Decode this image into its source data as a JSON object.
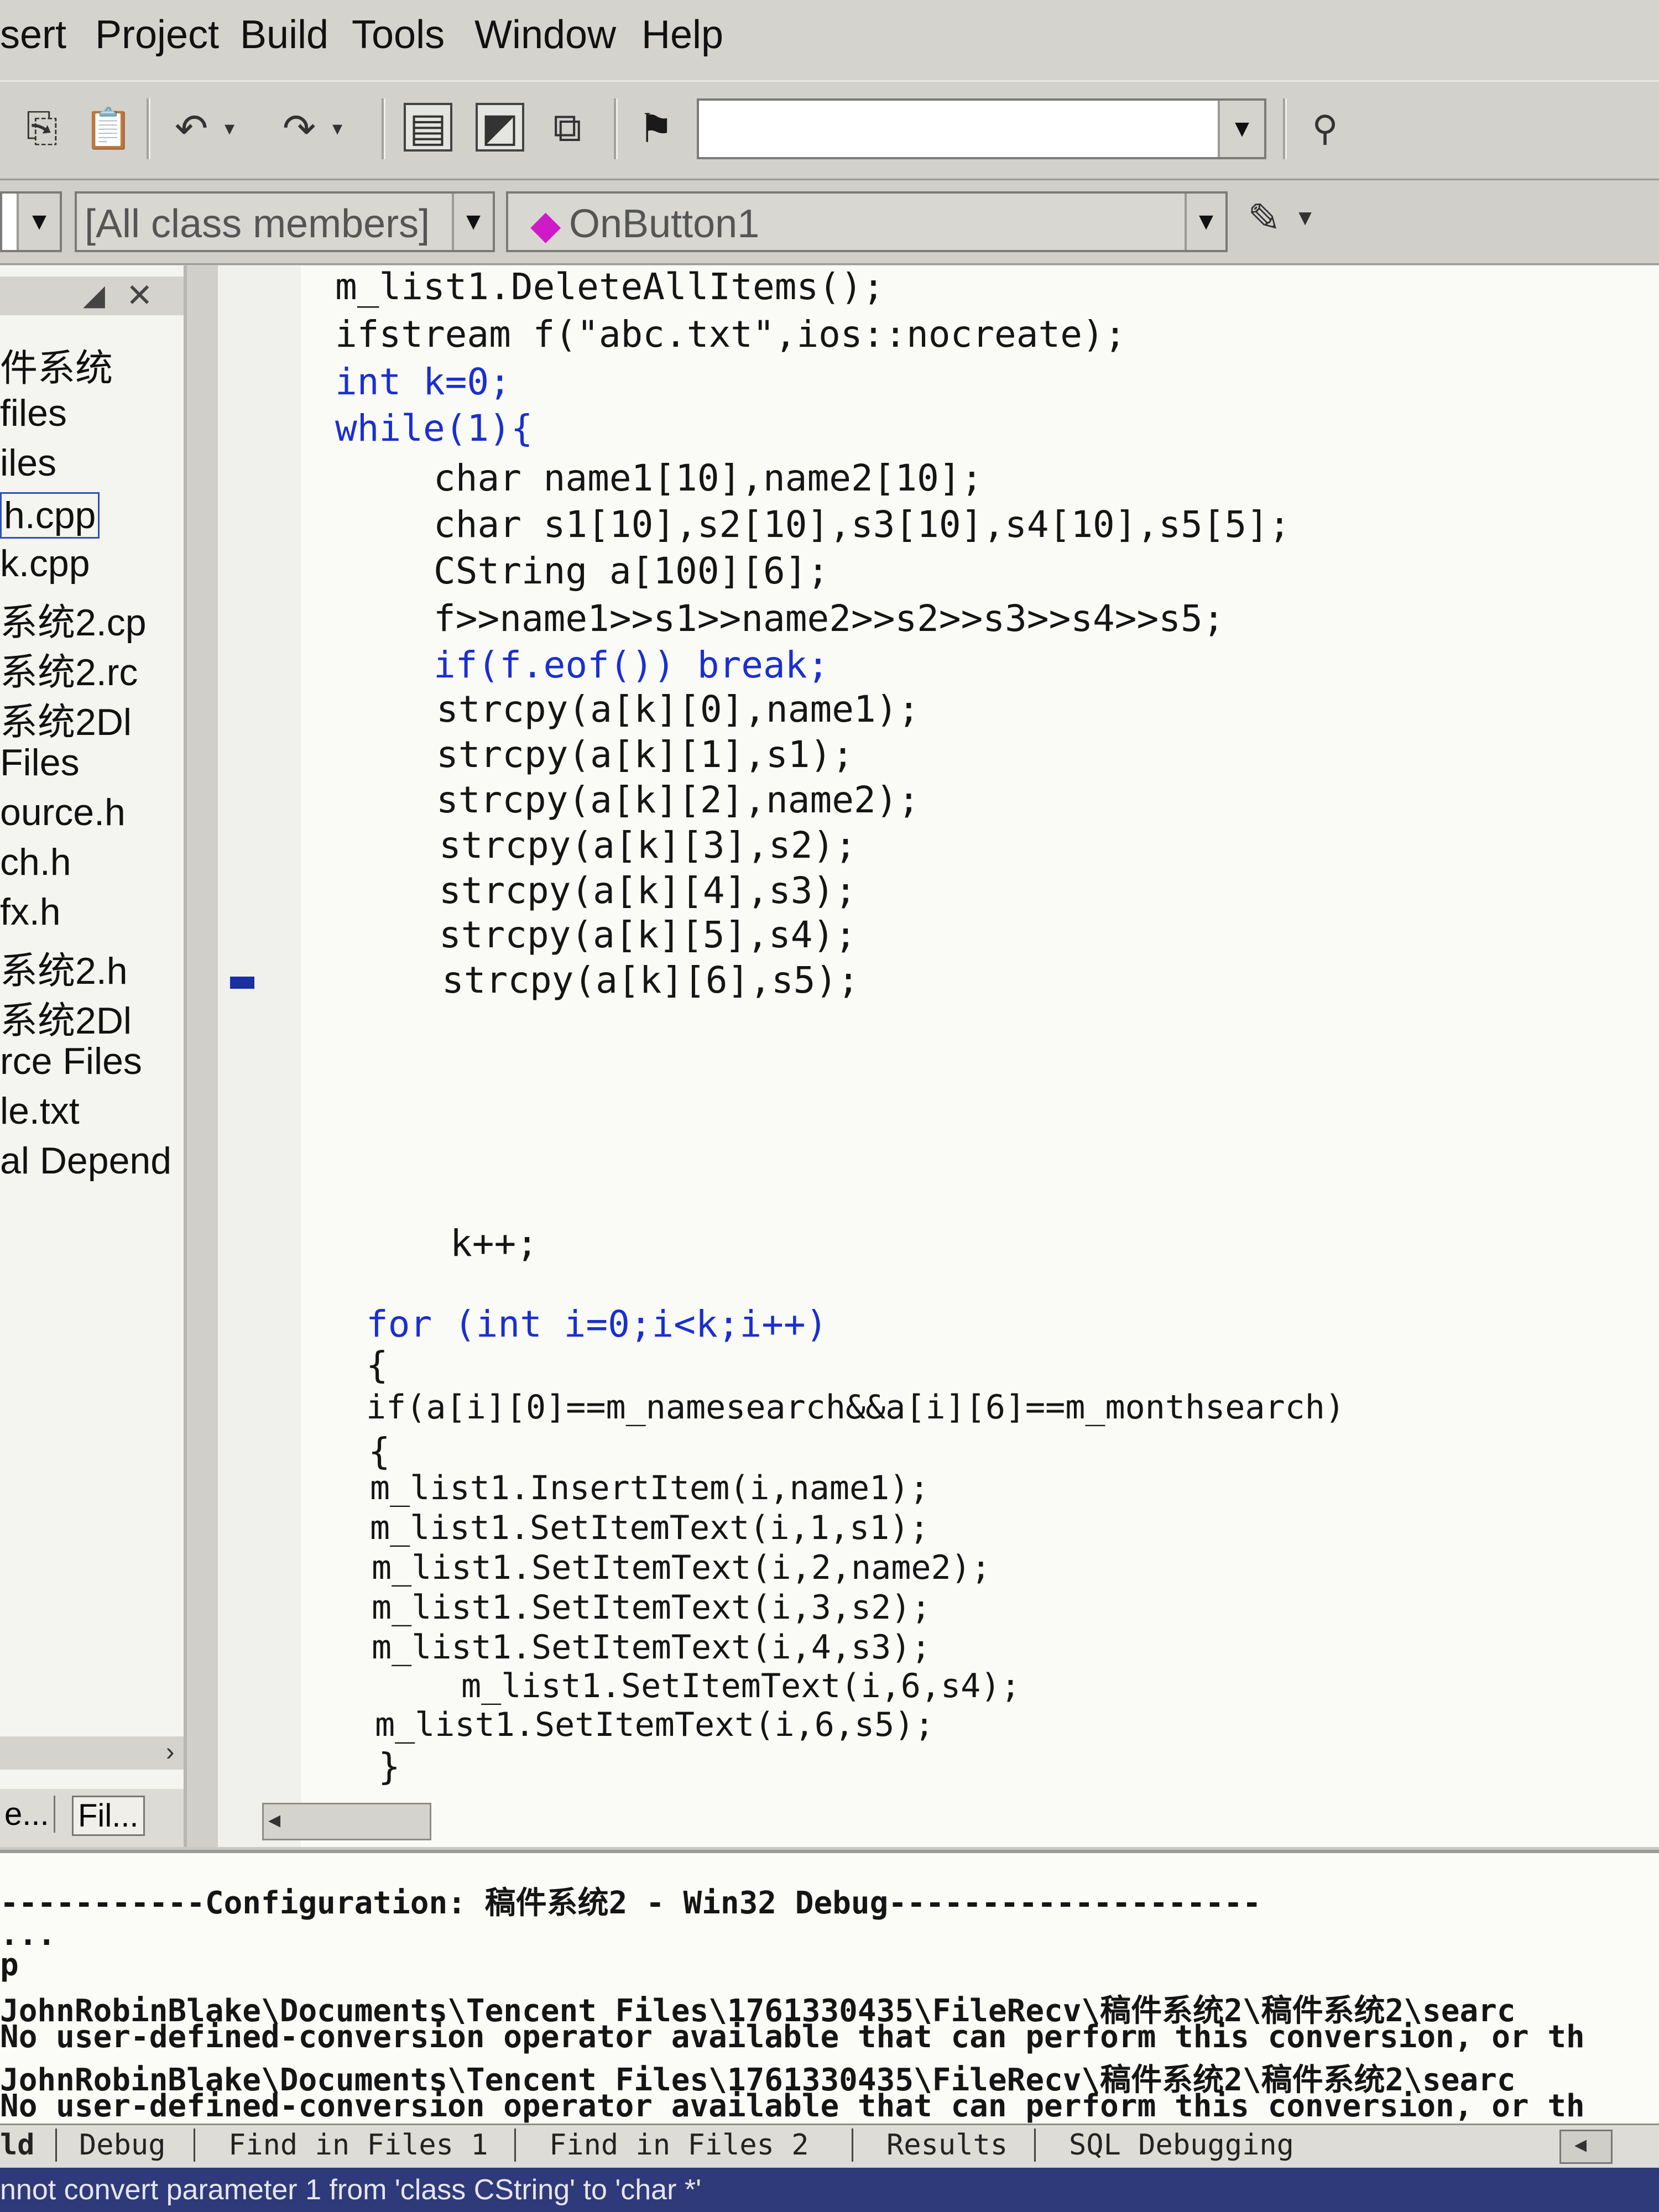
{
  "menu": [
    "sert",
    "Project",
    "Build",
    "Tools",
    "Window",
    "Help"
  ],
  "wizard": {
    "class_members": "[All class members]",
    "function": "OnButton1"
  },
  "workspace": {
    "items": [
      "件系统",
      "files",
      "iles",
      "h.cpp",
      "k.cpp",
      "系统2.cp",
      "系统2.rc",
      "系统2Dl",
      "Files",
      "ource.h",
      "ch.h",
      "fx.h",
      "系统2.h",
      "系统2Dl",
      "rce Files",
      "le.txt",
      "al Depend"
    ],
    "tabs": [
      "e...",
      "Fil..."
    ]
  },
  "code": [
    "m_list1.DeleteAllItems();",
    "ifstream f(\"abc.txt\",ios::nocreate);",
    "int k=0;",
    "while(1){",
    "char name1[10],name2[10];",
    "char s1[10],s2[10],s3[10],s4[10],s5[5];",
    "CString a[100][6];",
    "f>>name1>>s1>>name2>>s2>>s3>>s4>>s5;",
    "if(f.eof()) break;",
    "strcpy(a[k][0],name1);",
    "strcpy(a[k][1],s1);",
    "strcpy(a[k][2],name2);",
    "strcpy(a[k][3],s2);",
    "strcpy(a[k][4],s3);",
    "strcpy(a[k][5],s4);",
    "strcpy(a[k][6],s5);",
    "k++;",
    "for (int i=0;i<k;i++)",
    "{",
    "if(a[i][0]==m_namesearch&&a[i][6]==m_monthsearch)",
    "{",
    "m_list1.InsertItem(i,name1);",
    "m_list1.SetItemText(i,1,s1);",
    "m_list1.SetItemText(i,2,name2);",
    "m_list1.SetItemText(i,3,s2);",
    "m_list1.SetItemText(i,4,s3);",
    "m_list1.SetItemText(i,6,s4);",
    "m_list1.SetItemText(i,6,s5);",
    "}"
  ],
  "output": {
    "lines": [
      "-----------Configuration: 稿件系统2 - Win32 Debug--------------------",
      "...",
      "p",
      "JohnRobinBlake\\Documents\\Tencent Files\\1761330435\\FileRecv\\稿件系统2\\稿件系统2\\searc",
      "No user-defined-conversion operator available that can perform this conversion, or th",
      "JohnRobinBlake\\Documents\\Tencent Files\\1761330435\\FileRecv\\稿件系统2\\稿件系统2\\searc",
      "No user-defined-conversion operator available that can perform this conversion, or th"
    ],
    "tabs": [
      "ld",
      "Debug",
      "Find in Files 1",
      "Find in Files 2",
      "Results",
      "SQL Debugging"
    ]
  },
  "status": "nnot convert parameter 1 from 'class CString' to 'char *'"
}
